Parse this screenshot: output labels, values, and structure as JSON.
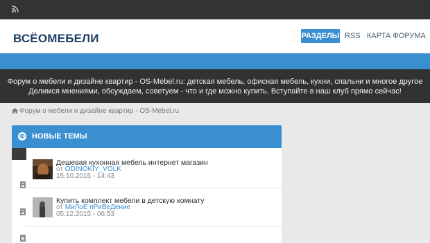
{
  "topbar": {
    "icon": "rss-icon"
  },
  "header": {
    "logo": "ВСЁОМЕБЕЛИ",
    "nav": {
      "sections": "РАЗДЕЛЫ",
      "rss": "RSS",
      "forum_map": "КАРТА ФОРУМА"
    },
    "accent": "#3a8fd1"
  },
  "banner": {
    "line1": "Форум о мебели и дизайне квартир - OS-Mebel.ru: детская мебель, офисная мебель, кухни, спальни и многое другое",
    "line2": "Делимся мнениями, обсуждаем, советуем - что и где можно купить. Вступайте в наш клуб прямо сейчас!"
  },
  "breadcrumb": {
    "icon": "home-icon",
    "text": "Форум о мебели и дизайне квартир - OS-Mebel.ru"
  },
  "panel": {
    "icon": "Ф",
    "title": "НОВЫЕ ТЕМЫ",
    "topics": [
      {
        "title": "Дешевая кухонная мебель интернет магазин",
        "by_label": "от",
        "author": "ODINOKIY_VOLK",
        "date": "15.10.2015 - 14:43"
      },
      {
        "title": "Купить комплект мебели в детскую комнату",
        "by_label": "от",
        "author": "МиЛоЕ пРиВеДение",
        "date": "05.12.2015 - 06:53"
      }
    ]
  }
}
